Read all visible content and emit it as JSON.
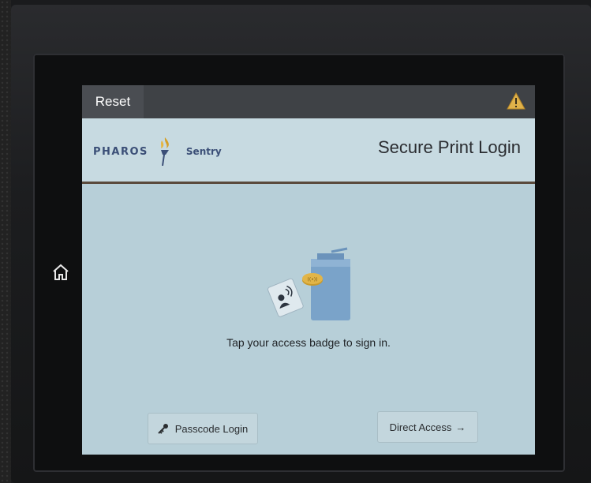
{
  "topbar": {
    "reset_label": "Reset",
    "warning_icon": "warning-icon"
  },
  "brand": {
    "name": "PHAROS",
    "product": "Sentry",
    "page_title": "Secure Print Login"
  },
  "main": {
    "instruction": "Tap your access badge to sign in.",
    "passcode_label": "Passcode Login",
    "passcode_icon": "key-icon",
    "direct_label": "Direct Access",
    "direct_arrow": "→"
  },
  "device": {
    "home_icon": "home-icon"
  },
  "colors": {
    "screen_bg": "#b7cfd8",
    "topbar_bg": "#3f4246",
    "brand_blue": "#3b4f77",
    "accent_gold": "#d4a028"
  }
}
